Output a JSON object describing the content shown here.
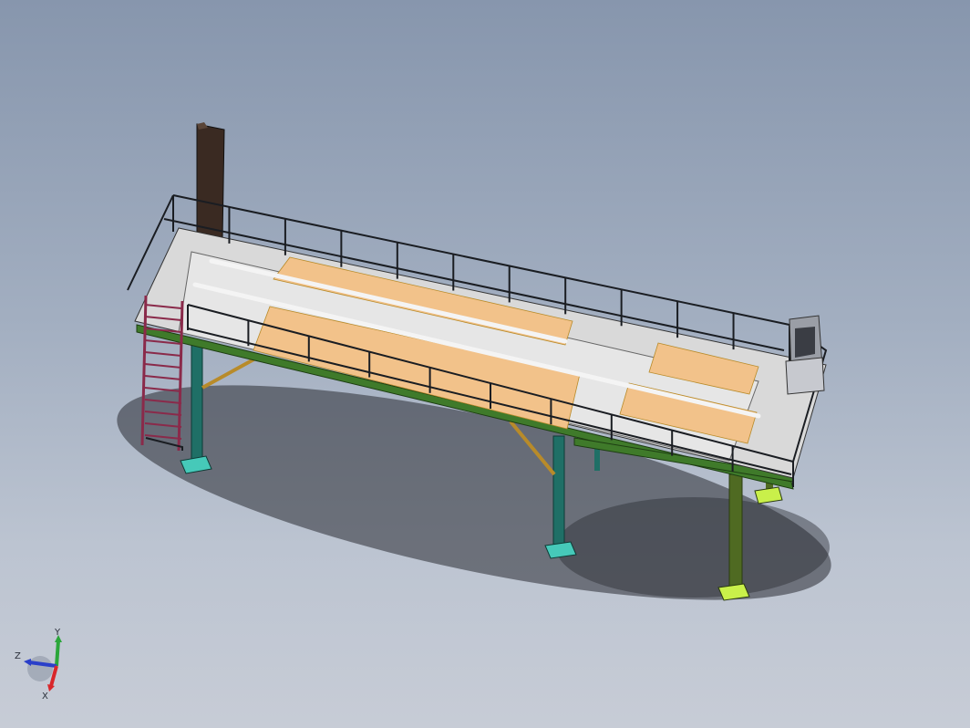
{
  "viewport": {
    "background_top": "#8796ad",
    "background_bottom": "#c7ccd6"
  },
  "model": {
    "colors": {
      "railing": "#1a1d22",
      "deck": "#d9d9d9",
      "grating": "#f2c28a",
      "beam_green": "#3f7a2a",
      "column_teal": "#1f6f66",
      "column_olive": "#4f6a22",
      "base_plate": "#46c9b9",
      "base_plate_yellow": "#c9f04a",
      "ladder": "#8a2a4a",
      "chimney": "#3a2a22",
      "brace": "#b88b2a",
      "cabinet": "#9a9ea6",
      "shadow": "#2a2c33"
    }
  },
  "triad": {
    "labels": {
      "y": "Y",
      "z": "Z",
      "x": "X"
    },
    "colors": {
      "y": "#2aa63a",
      "z": "#2a3fc9",
      "x": "#d9262a"
    }
  }
}
